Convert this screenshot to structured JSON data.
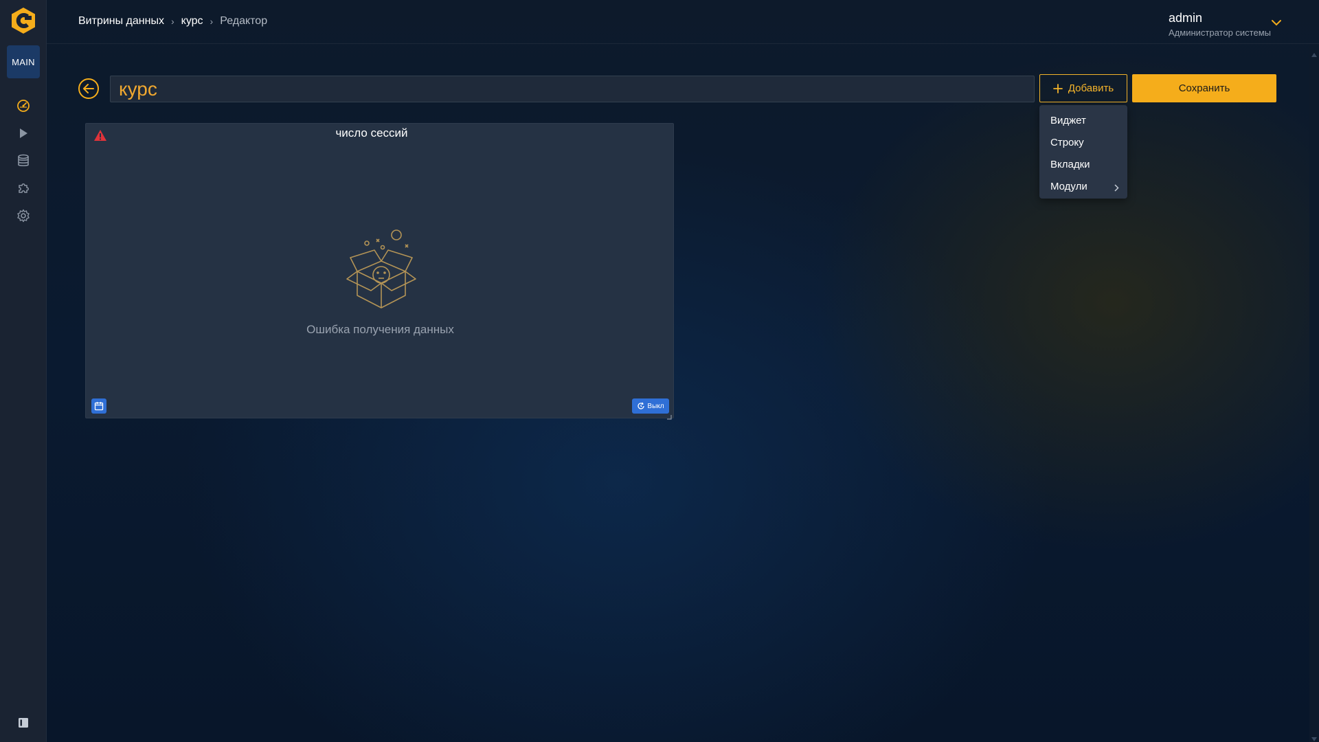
{
  "sidebar": {
    "workspace_badge": "MAIN",
    "items": [
      {
        "icon": "dashboard-icon"
      },
      {
        "icon": "play-icon"
      },
      {
        "icon": "database-icon"
      },
      {
        "icon": "puzzle-icon"
      },
      {
        "icon": "gear-icon"
      }
    ],
    "bottom_icon": "panel-toggle-icon"
  },
  "breadcrumb": {
    "items": [
      "Витрины данных",
      "курс",
      "Редактор"
    ]
  },
  "user": {
    "name": "admin",
    "role": "Администратор системы"
  },
  "editor": {
    "title_value": "курс",
    "add_label": "Добавить",
    "save_label": "Сохранить"
  },
  "add_menu": {
    "items": [
      "Виджет",
      "Строку",
      "Вкладки",
      "Модули"
    ]
  },
  "widget": {
    "title": "число сессий",
    "empty_text": "Ошибка получения данных",
    "refresh_label": "Выкл"
  },
  "colors": {
    "accent": "#f5ad1b",
    "sidebar_bg": "#1a2332",
    "card_bg": "#253244",
    "blue_button": "#2f6fd6",
    "warning": "#e0333a"
  }
}
